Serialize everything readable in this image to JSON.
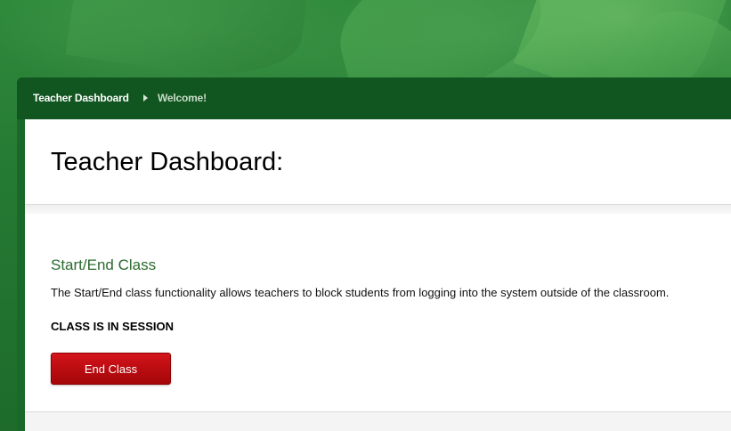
{
  "breadcrumb": {
    "home_label": "Teacher Dashboard",
    "current_label": "Welcome!"
  },
  "page": {
    "title": "Teacher Dashboard:"
  },
  "section": {
    "title": "Start/End Class",
    "description": "The Start/End class functionality allows teachers to block students from logging into the system outside of the classroom.",
    "status": "CLASS IS IN SESSION",
    "end_button_label": "End Class"
  },
  "colors": {
    "brand_green": "#19692a",
    "section_title": "#2c6a2f",
    "end_button": "#c00f14"
  },
  "icons": {
    "breadcrumb_separator": "chevron-right-icon"
  }
}
